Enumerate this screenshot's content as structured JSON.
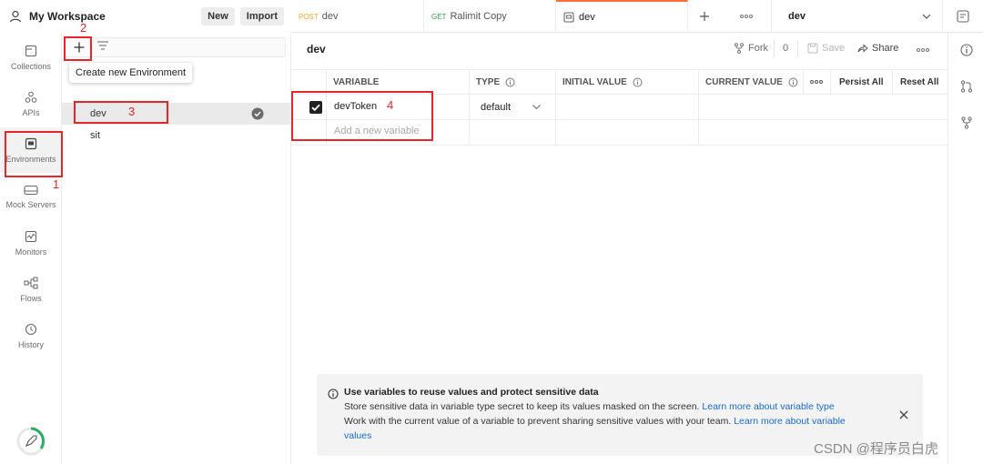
{
  "workspace": {
    "title": "My Workspace",
    "new_label": "New",
    "import_label": "Import"
  },
  "tabs": [
    {
      "method": "POST",
      "method_color": "#f5a623",
      "label": "dev"
    },
    {
      "method": "GET",
      "method_color": "#2f9e44",
      "label": "Ralimit Copy"
    },
    {
      "method": "",
      "label": "dev",
      "active": true
    }
  ],
  "env_selector": {
    "value": "dev"
  },
  "rail": [
    {
      "label": "Collections",
      "icon": "collections-icon"
    },
    {
      "label": "APIs",
      "icon": "apis-icon"
    },
    {
      "label": "Environments",
      "icon": "environments-icon",
      "active": true
    },
    {
      "label": "Mock Servers",
      "icon": "mock-servers-icon"
    },
    {
      "label": "Monitors",
      "icon": "monitors-icon"
    },
    {
      "label": "Flows",
      "icon": "flows-icon"
    },
    {
      "label": "History",
      "icon": "history-icon"
    }
  ],
  "tooltip": "Create new Environment",
  "environments": [
    {
      "name": "dev",
      "active": true
    },
    {
      "name": "sit"
    }
  ],
  "main": {
    "title": "dev",
    "fork_label": "Fork",
    "fork_count": "0",
    "save_label": "Save",
    "share_label": "Share"
  },
  "table": {
    "headers": {
      "variable": "VARIABLE",
      "type": "TYPE",
      "initial": "INITIAL VALUE",
      "current": "CURRENT VALUE",
      "persist_all": "Persist All",
      "reset_all": "Reset All"
    },
    "rows": [
      {
        "checked": true,
        "variable": "devToken",
        "type": "default",
        "initial": "",
        "current": ""
      }
    ],
    "add_placeholder": "Add a new variable"
  },
  "annotations": [
    "1",
    "2",
    "3",
    "4"
  ],
  "banner": {
    "title": "Use variables to reuse values and protect sensitive data",
    "line1": "Store sensitive data in variable type secret to keep its values masked on the screen.",
    "link1": "Learn more about variable type",
    "line2": "Work with the current value of a variable to prevent sharing sensitive values with your team.",
    "link2": "Learn more about variable",
    "link2_wrap": "values"
  },
  "watermark": "CSDN @程序员白虎",
  "colors": {
    "accent": "#ff6c37",
    "annotation": "#e5262a",
    "link": "#1a6ad0"
  }
}
